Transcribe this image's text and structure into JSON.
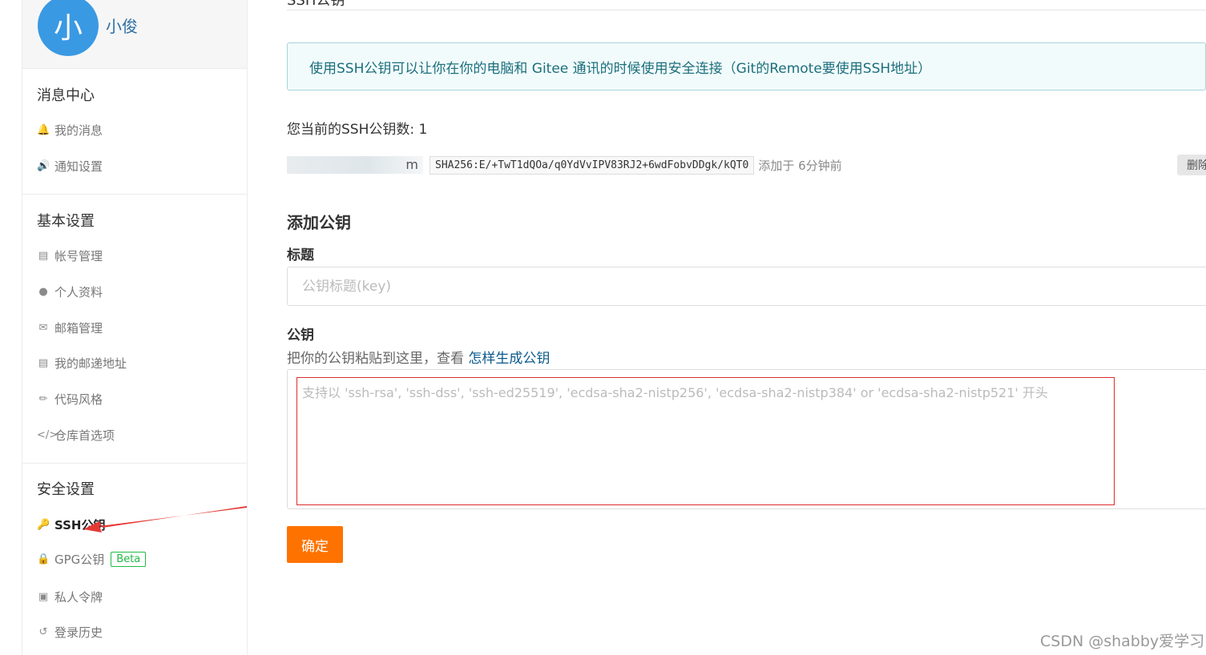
{
  "profile": {
    "avatar_text": "小",
    "username": "小俊"
  },
  "sidebar": {
    "sections": [
      {
        "title": "消息中心",
        "items": [
          {
            "label": "我的消息",
            "icon": "bell-icon"
          },
          {
            "label": "通知设置",
            "icon": "speaker-icon"
          }
        ]
      },
      {
        "title": "基本设置",
        "items": [
          {
            "label": "帐号管理",
            "icon": "id-card-icon"
          },
          {
            "label": "个人资料",
            "icon": "user-icon"
          },
          {
            "label": "邮箱管理",
            "icon": "envelope-icon"
          },
          {
            "label": "我的邮递地址",
            "icon": "address-card-icon"
          },
          {
            "label": "代码风格",
            "icon": "brush-icon"
          },
          {
            "label": "仓库首选项",
            "icon": "code-icon"
          }
        ]
      },
      {
        "title": "安全设置",
        "items": [
          {
            "label": "SSH公钥",
            "icon": "key-icon",
            "active": true
          },
          {
            "label": "GPG公钥",
            "icon": "lock-icon",
            "badge": "Beta"
          },
          {
            "label": "私人令牌",
            "icon": "user-secret-icon"
          },
          {
            "label": "登录历史",
            "icon": "history-icon"
          }
        ]
      }
    ]
  },
  "main": {
    "page_title": "SSH公钥",
    "info_text": "使用SSH公钥可以让你在你的电脑和 Gitee 通讯的时候使用安全连接（Git的Remote要使用SSH地址）",
    "key_count_text": "您当前的SSH公钥数: 1",
    "key": {
      "name_suffix": "m",
      "fingerprint": "SHA256:E/+TwT1dQOa/q0YdVvIPV83RJ2+6wdFobvDDgk/kQT0",
      "added": "添加于 6分钟前",
      "delete_label": "删除"
    },
    "add_title": "添加公钥",
    "title_label": "标题",
    "title_placeholder": "公钥标题(key)",
    "key_label": "公钥",
    "hint_text": "把你的公钥粘贴到这里，查看 ",
    "hint_link": "怎样生成公钥",
    "key_placeholder": "支持以 'ssh-rsa', 'ssh-dss', 'ssh-ed25519', 'ecdsa-sha2-nistp256', 'ecdsa-sha2-nistp384' or 'ecdsa-sha2-nistp521' 开头",
    "submit_label": "确定"
  },
  "watermark": "CSDN @shabby爱学习",
  "colors": {
    "accent": "#fe7300",
    "avatar": "#3a99e3",
    "highlight_border": "#e02d2d",
    "annotation_arrow": "#e53935"
  }
}
